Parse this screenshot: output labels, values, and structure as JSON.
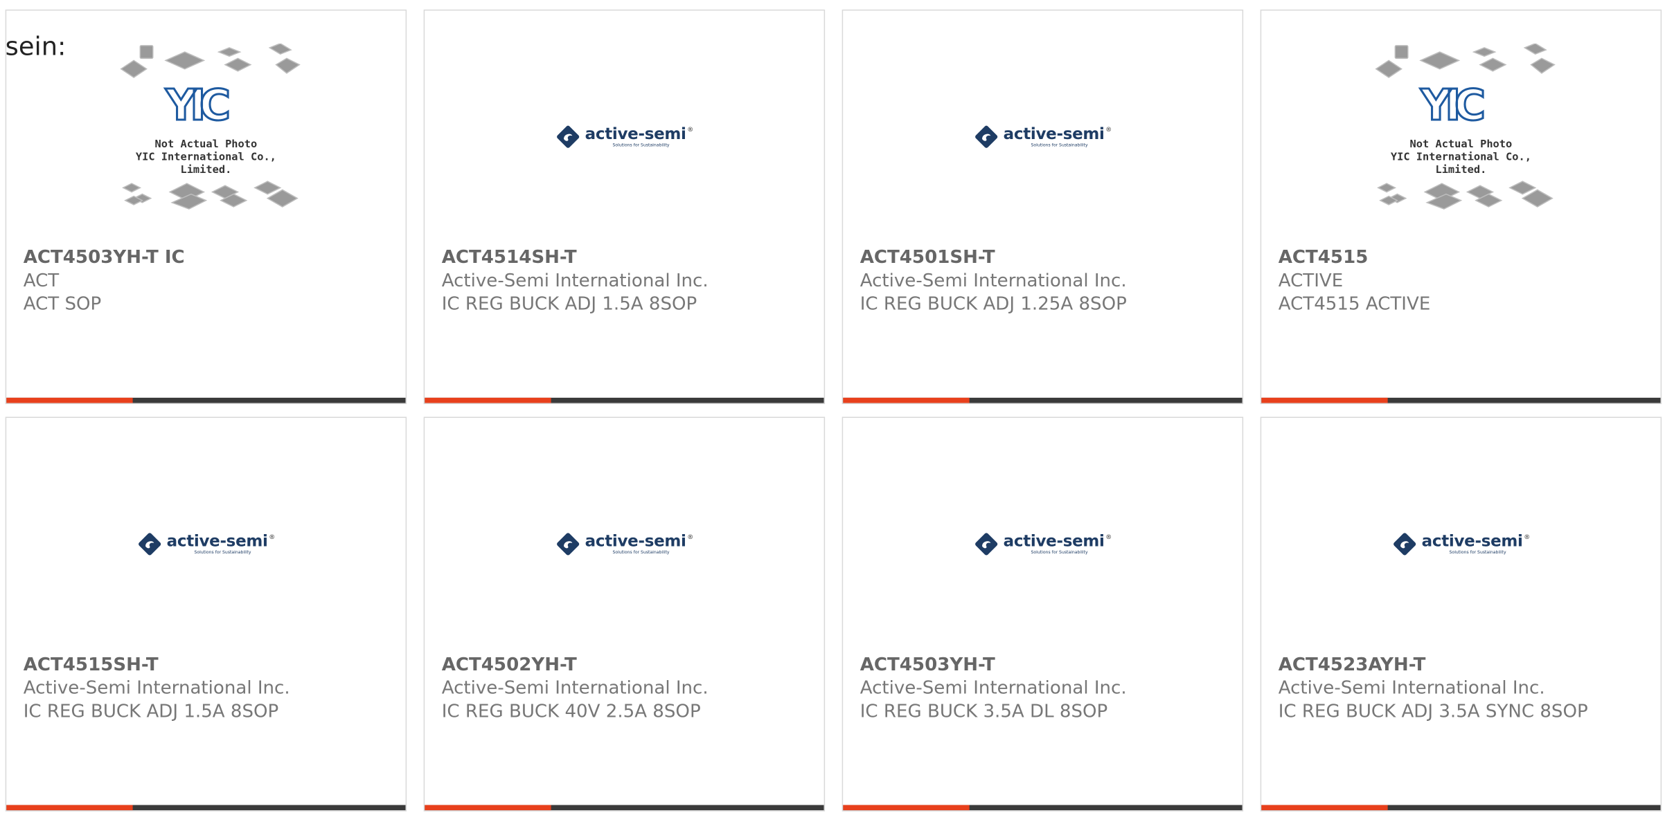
{
  "intro_text": "sein:",
  "colors": {
    "accent": "#e8401c",
    "bar": "#3a3a3a",
    "logo_blue": "#1e3c64",
    "yic_blue": "#1e5aa0"
  },
  "logos": {
    "active_semi": {
      "brand": "active-semi",
      "registered": "®",
      "tagline": "Solutions for Sustainability"
    },
    "yic": {
      "letters": "YIC",
      "caption_line1": "Not Actual Photo",
      "caption_line2": "YIC International Co., Limited."
    }
  },
  "products": [
    {
      "part_number": "ACT4503YH-T IC",
      "manufacturer": "ACT",
      "description": "ACT SOP",
      "image": "yic-placeholder"
    },
    {
      "part_number": "ACT4514SH-T",
      "manufacturer": "Active-Semi International Inc.",
      "description": "IC REG BUCK ADJ 1.5A 8SOP",
      "image": "active-semi-logo"
    },
    {
      "part_number": "ACT4501SH-T",
      "manufacturer": "Active-Semi International Inc.",
      "description": "IC REG BUCK ADJ 1.25A 8SOP",
      "image": "active-semi-logo"
    },
    {
      "part_number": "ACT4515",
      "manufacturer": "ACTIVE",
      "description": "ACT4515 ACTIVE",
      "image": "yic-placeholder"
    },
    {
      "part_number": "ACT4515SH-T",
      "manufacturer": "Active-Semi International Inc.",
      "description": "IC REG BUCK ADJ 1.5A 8SOP",
      "image": "active-semi-logo"
    },
    {
      "part_number": "ACT4502YH-T",
      "manufacturer": "Active-Semi International Inc.",
      "description": "IC REG BUCK 40V 2.5A 8SOP",
      "image": "active-semi-logo"
    },
    {
      "part_number": "ACT4503YH-T",
      "manufacturer": "Active-Semi International Inc.",
      "description": "IC REG BUCK 3.5A DL 8SOP",
      "image": "active-semi-logo"
    },
    {
      "part_number": "ACT4523AYH-T",
      "manufacturer": "Active-Semi International Inc.",
      "description": "IC REG BUCK ADJ 3.5A SYNC 8SOP",
      "image": "active-semi-logo"
    }
  ]
}
